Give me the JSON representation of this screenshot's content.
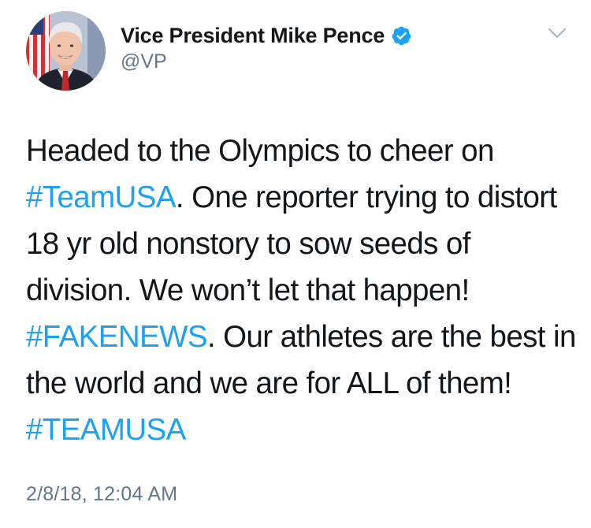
{
  "author": {
    "display_name": "Vice President Mike Pence",
    "handle": "@VP",
    "verified": true
  },
  "icons": {
    "verified": "verified-badge-icon",
    "menu": "chevron-down-icon"
  },
  "tweet": {
    "segments": [
      {
        "text": "Headed to the Olympics to cheer on ",
        "type": "text"
      },
      {
        "text": "#TeamUSA",
        "type": "hashtag"
      },
      {
        "text": ". One reporter trying to distort 18 yr old nonstory to sow seeds of division. We won’t let that happen! ",
        "type": "text"
      },
      {
        "text": "#FAKENEWS",
        "type": "hashtag"
      },
      {
        "text": ". Our athletes are the best in the world and we are for ALL of them! ",
        "type": "text"
      },
      {
        "text": "#TEAMUSA",
        "type": "hashtag"
      }
    ],
    "timestamp": "2/8/18, 12:04 AM"
  },
  "colors": {
    "link": "#1da1f2",
    "secondary_text": "#657786",
    "primary_text": "#14171a"
  }
}
